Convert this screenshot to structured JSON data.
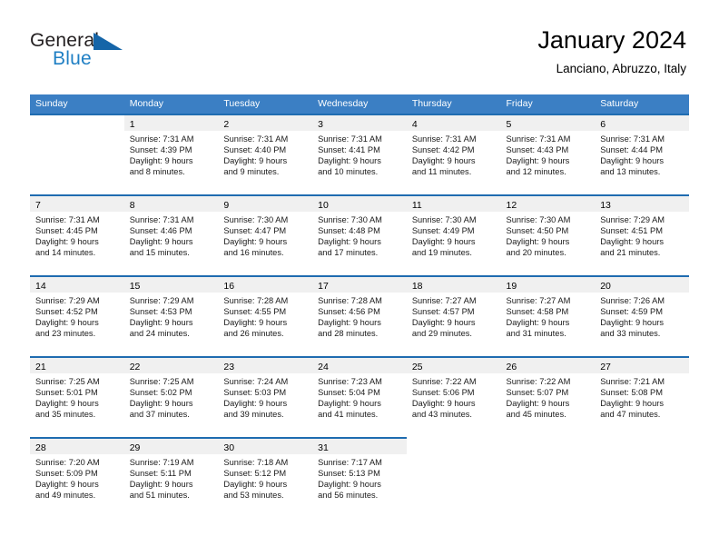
{
  "brand": {
    "word1": "General",
    "word2": "Blue",
    "logo_icon": "blue-triangle-logo",
    "accent_color": "#1565a8"
  },
  "header": {
    "title": "January 2024",
    "subtitle": "Lanciano, Abruzzo, Italy"
  },
  "theme": {
    "header_row_color": "#3b7fc4",
    "separator_color": "#1f6cb0",
    "day_band_color": "#f0f0f0"
  },
  "calendar": {
    "weekday_headers": [
      "Sunday",
      "Monday",
      "Tuesday",
      "Wednesday",
      "Thursday",
      "Friday",
      "Saturday"
    ],
    "weeks": [
      [
        {
          "day": "",
          "lines": []
        },
        {
          "day": "1",
          "lines": [
            "Sunrise: 7:31 AM",
            "Sunset: 4:39 PM",
            "Daylight: 9 hours",
            "and 8 minutes."
          ]
        },
        {
          "day": "2",
          "lines": [
            "Sunrise: 7:31 AM",
            "Sunset: 4:40 PM",
            "Daylight: 9 hours",
            "and 9 minutes."
          ]
        },
        {
          "day": "3",
          "lines": [
            "Sunrise: 7:31 AM",
            "Sunset: 4:41 PM",
            "Daylight: 9 hours",
            "and 10 minutes."
          ]
        },
        {
          "day": "4",
          "lines": [
            "Sunrise: 7:31 AM",
            "Sunset: 4:42 PM",
            "Daylight: 9 hours",
            "and 11 minutes."
          ]
        },
        {
          "day": "5",
          "lines": [
            "Sunrise: 7:31 AM",
            "Sunset: 4:43 PM",
            "Daylight: 9 hours",
            "and 12 minutes."
          ]
        },
        {
          "day": "6",
          "lines": [
            "Sunrise: 7:31 AM",
            "Sunset: 4:44 PM",
            "Daylight: 9 hours",
            "and 13 minutes."
          ]
        }
      ],
      [
        {
          "day": "7",
          "lines": [
            "Sunrise: 7:31 AM",
            "Sunset: 4:45 PM",
            "Daylight: 9 hours",
            "and 14 minutes."
          ]
        },
        {
          "day": "8",
          "lines": [
            "Sunrise: 7:31 AM",
            "Sunset: 4:46 PM",
            "Daylight: 9 hours",
            "and 15 minutes."
          ]
        },
        {
          "day": "9",
          "lines": [
            "Sunrise: 7:30 AM",
            "Sunset: 4:47 PM",
            "Daylight: 9 hours",
            "and 16 minutes."
          ]
        },
        {
          "day": "10",
          "lines": [
            "Sunrise: 7:30 AM",
            "Sunset: 4:48 PM",
            "Daylight: 9 hours",
            "and 17 minutes."
          ]
        },
        {
          "day": "11",
          "lines": [
            "Sunrise: 7:30 AM",
            "Sunset: 4:49 PM",
            "Daylight: 9 hours",
            "and 19 minutes."
          ]
        },
        {
          "day": "12",
          "lines": [
            "Sunrise: 7:30 AM",
            "Sunset: 4:50 PM",
            "Daylight: 9 hours",
            "and 20 minutes."
          ]
        },
        {
          "day": "13",
          "lines": [
            "Sunrise: 7:29 AM",
            "Sunset: 4:51 PM",
            "Daylight: 9 hours",
            "and 21 minutes."
          ]
        }
      ],
      [
        {
          "day": "14",
          "lines": [
            "Sunrise: 7:29 AM",
            "Sunset: 4:52 PM",
            "Daylight: 9 hours",
            "and 23 minutes."
          ]
        },
        {
          "day": "15",
          "lines": [
            "Sunrise: 7:29 AM",
            "Sunset: 4:53 PM",
            "Daylight: 9 hours",
            "and 24 minutes."
          ]
        },
        {
          "day": "16",
          "lines": [
            "Sunrise: 7:28 AM",
            "Sunset: 4:55 PM",
            "Daylight: 9 hours",
            "and 26 minutes."
          ]
        },
        {
          "day": "17",
          "lines": [
            "Sunrise: 7:28 AM",
            "Sunset: 4:56 PM",
            "Daylight: 9 hours",
            "and 28 minutes."
          ]
        },
        {
          "day": "18",
          "lines": [
            "Sunrise: 7:27 AM",
            "Sunset: 4:57 PM",
            "Daylight: 9 hours",
            "and 29 minutes."
          ]
        },
        {
          "day": "19",
          "lines": [
            "Sunrise: 7:27 AM",
            "Sunset: 4:58 PM",
            "Daylight: 9 hours",
            "and 31 minutes."
          ]
        },
        {
          "day": "20",
          "lines": [
            "Sunrise: 7:26 AM",
            "Sunset: 4:59 PM",
            "Daylight: 9 hours",
            "and 33 minutes."
          ]
        }
      ],
      [
        {
          "day": "21",
          "lines": [
            "Sunrise: 7:25 AM",
            "Sunset: 5:01 PM",
            "Daylight: 9 hours",
            "and 35 minutes."
          ]
        },
        {
          "day": "22",
          "lines": [
            "Sunrise: 7:25 AM",
            "Sunset: 5:02 PM",
            "Daylight: 9 hours",
            "and 37 minutes."
          ]
        },
        {
          "day": "23",
          "lines": [
            "Sunrise: 7:24 AM",
            "Sunset: 5:03 PM",
            "Daylight: 9 hours",
            "and 39 minutes."
          ]
        },
        {
          "day": "24",
          "lines": [
            "Sunrise: 7:23 AM",
            "Sunset: 5:04 PM",
            "Daylight: 9 hours",
            "and 41 minutes."
          ]
        },
        {
          "day": "25",
          "lines": [
            "Sunrise: 7:22 AM",
            "Sunset: 5:06 PM",
            "Daylight: 9 hours",
            "and 43 minutes."
          ]
        },
        {
          "day": "26",
          "lines": [
            "Sunrise: 7:22 AM",
            "Sunset: 5:07 PM",
            "Daylight: 9 hours",
            "and 45 minutes."
          ]
        },
        {
          "day": "27",
          "lines": [
            "Sunrise: 7:21 AM",
            "Sunset: 5:08 PM",
            "Daylight: 9 hours",
            "and 47 minutes."
          ]
        }
      ],
      [
        {
          "day": "28",
          "lines": [
            "Sunrise: 7:20 AM",
            "Sunset: 5:09 PM",
            "Daylight: 9 hours",
            "and 49 minutes."
          ]
        },
        {
          "day": "29",
          "lines": [
            "Sunrise: 7:19 AM",
            "Sunset: 5:11 PM",
            "Daylight: 9 hours",
            "and 51 minutes."
          ]
        },
        {
          "day": "30",
          "lines": [
            "Sunrise: 7:18 AM",
            "Sunset: 5:12 PM",
            "Daylight: 9 hours",
            "and 53 minutes."
          ]
        },
        {
          "day": "31",
          "lines": [
            "Sunrise: 7:17 AM",
            "Sunset: 5:13 PM",
            "Daylight: 9 hours",
            "and 56 minutes."
          ]
        },
        {
          "day": "",
          "lines": []
        },
        {
          "day": "",
          "lines": []
        },
        {
          "day": "",
          "lines": []
        }
      ]
    ]
  }
}
